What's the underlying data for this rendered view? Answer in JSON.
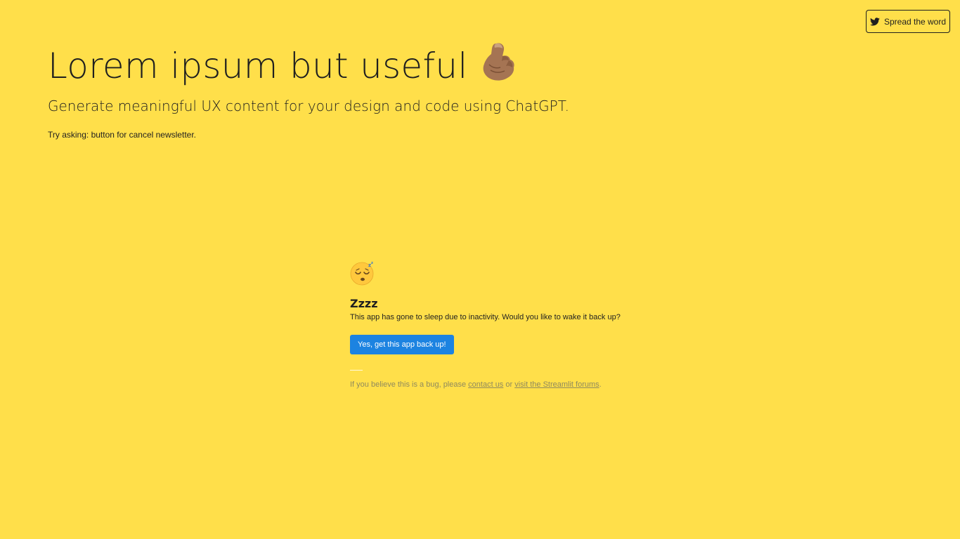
{
  "share": {
    "label": "Spread the word",
    "icon": "twitter-icon"
  },
  "header": {
    "title": "Lorem ipsum but useful",
    "title_icon": "pinched-fingers-icon",
    "subtitle": "Generate meaningful UX content for your design and code using ChatGPT.",
    "hint": "Try asking: button for cancel newsletter."
  },
  "sleep": {
    "icon": "sleeping-face-icon",
    "heading": "Zzzz",
    "message": "This app has gone to sleep due to inactivity. Would you like to wake it back up?",
    "button_label": "Yes, get this app back up!",
    "footer_prefix": "If you believe this is a bug, please ",
    "contact_link": "contact us",
    "footer_middle": " or ",
    "forums_link": "visit the Streamlit forums",
    "footer_suffix": "."
  },
  "colors": {
    "background": "#FFDF4A",
    "primary_button": "#1C83E1",
    "text": "#1F1F1F",
    "muted_text": "#8F8A5D"
  }
}
